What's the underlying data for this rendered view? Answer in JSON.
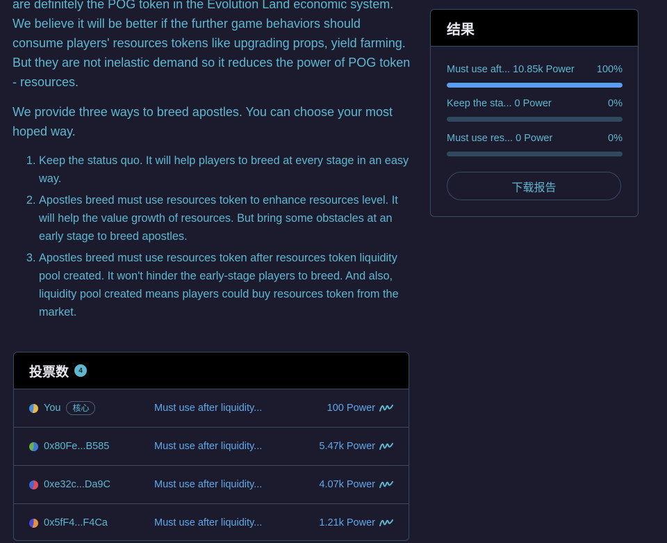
{
  "content": {
    "paragraph1": "are definitely the POG token in the Evolution Land economic system. We believe it will be better if the further game behaviors should consume players' resources tokens like upgrading props, yield farming. But they are not inelastic demand so it reduces the power of POG token - resources.",
    "paragraph2": "We provide three ways to breed apostles. You can choose your most hoped way.",
    "options": [
      "Keep the status quo. It will help players to breed at every stage in an easy way.",
      "Apostles breed must use resources token to enhance resources level. It will help the value growth of resources. But bring some obstacles at an early stage to breed apostles.",
      "Apostles breed must use resources token after resources token liquidity pool created. It won't hinder the early-stage players to breed. And also, liquidity pool created means players could buy resources token from the market."
    ]
  },
  "results": {
    "title": "结果",
    "items": [
      {
        "label": "Must use aft... 10.85k Power",
        "percent_text": "100%",
        "percent": 100
      },
      {
        "label": "Keep the sta... 0 Power",
        "percent_text": "0%",
        "percent": 0
      },
      {
        "label": "Must use res... 0 Power",
        "percent_text": "0%",
        "percent": 0
      }
    ],
    "download_label": "下载报告"
  },
  "votes": {
    "title": "投票数",
    "count": "4",
    "rows": [
      {
        "voter": "You",
        "tag": "核心",
        "choice": "Must use after liquidity...",
        "power": "100 Power",
        "avatar_colors": [
          "#e8b84a",
          "#4a8fd8"
        ]
      },
      {
        "voter": "0x80Fe...B585",
        "tag": "",
        "choice": "Must use after liquidity...",
        "power": "5.47k Power",
        "avatar_colors": [
          "#3d7ad6",
          "#6bb04a"
        ]
      },
      {
        "voter": "0xe32c...Da9C",
        "tag": "",
        "choice": "Must use after liquidity...",
        "power": "4.07k Power",
        "avatar_colors": [
          "#e04a5a",
          "#3d6ad6"
        ]
      },
      {
        "voter": "0x5fF4...F4Ca",
        "tag": "",
        "choice": "Must use after liquidity...",
        "power": "1.21k Power",
        "avatar_colors": [
          "#e8903a",
          "#4a4ad8"
        ]
      }
    ]
  },
  "icons": {
    "signature": "signature-icon",
    "avatar": "avatar-icon"
  }
}
